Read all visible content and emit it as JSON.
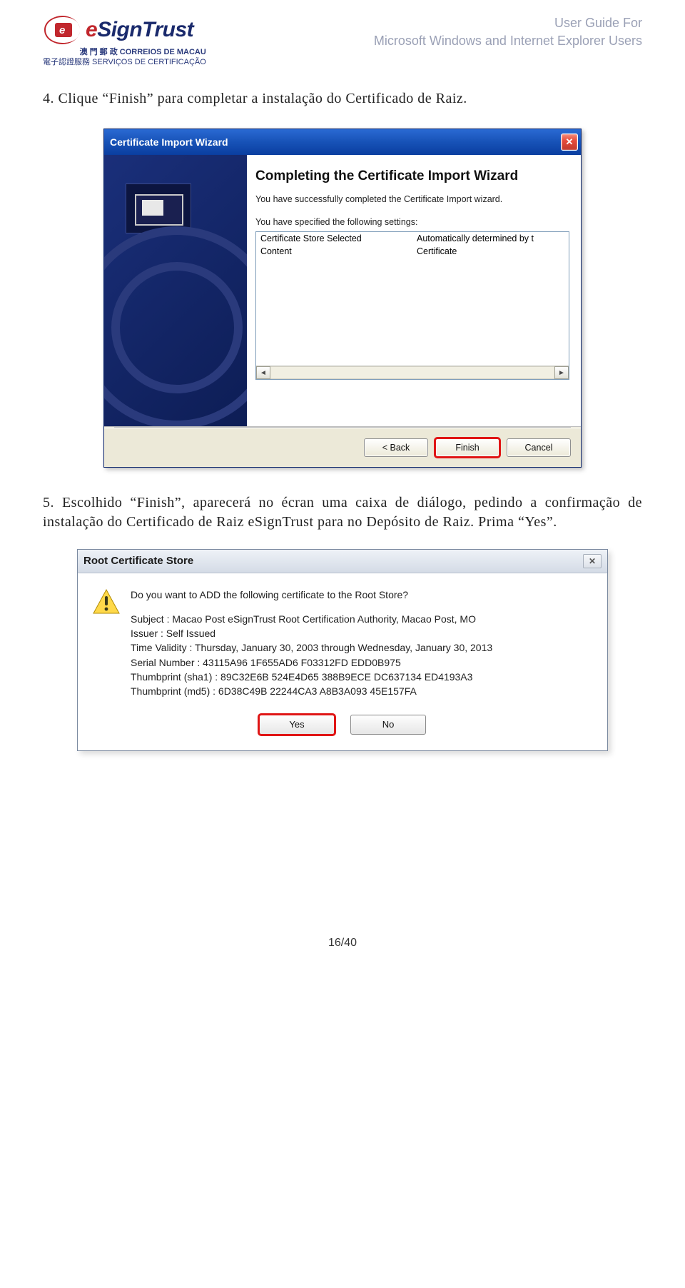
{
  "header": {
    "brand_main": "SignTrust",
    "brand_prefix_e": "e",
    "sub_line1": "澳 門 郵 政 CORREIOS DE MACAU",
    "sub_line2": "電子認證服務 SERVIÇOS DE CERTIFICAÇÃO",
    "doc_title_1": "User Guide For",
    "doc_title_2": "Microsoft Windows and Internet Explorer Users"
  },
  "body": {
    "step4": "4. Clique “Finish” para completar a instalação do Certificado de Raiz.",
    "step5": "5. Escolhido “Finish”, aparecerá no écran uma caixa de diálogo, pedindo a confirmação de instalação do Certificado de Raiz eSignTrust para no Depósito de Raiz. Prima “Yes”."
  },
  "wizard": {
    "title": "Certificate Import Wizard",
    "heading": "Completing the Certificate Import Wizard",
    "para1": "You have successfully completed the Certificate Import wizard.",
    "para2": "You have specified the following settings:",
    "settings": [
      {
        "label": "Certificate Store Selected",
        "value": "Automatically determined by t"
      },
      {
        "label": "Content",
        "value": "Certificate"
      }
    ],
    "buttons": {
      "back": "< Back",
      "finish": "Finish",
      "cancel": "Cancel"
    }
  },
  "rootdlg": {
    "title": "Root Certificate Store",
    "question": "Do you want to ADD the following certificate to the Root Store?",
    "lines": [
      "Subject : Macao Post eSignTrust Root Certification Authority, Macao Post, MO",
      "Issuer : Self Issued",
      "Time Validity : Thursday, January 30, 2003 through Wednesday, January 30, 2013",
      "Serial Number : 43115A96 1F655AD6 F03312FD EDD0B975",
      "Thumbprint (sha1) : 89C32E6B 524E4D65 388B9ECE DC637134 ED4193A3",
      "Thumbprint (md5) : 6D38C49B 22244CA3 A8B3A093 45E157FA"
    ],
    "buttons": {
      "yes": "Yes",
      "no": "No"
    }
  },
  "footer": {
    "page_num": "16/40"
  }
}
